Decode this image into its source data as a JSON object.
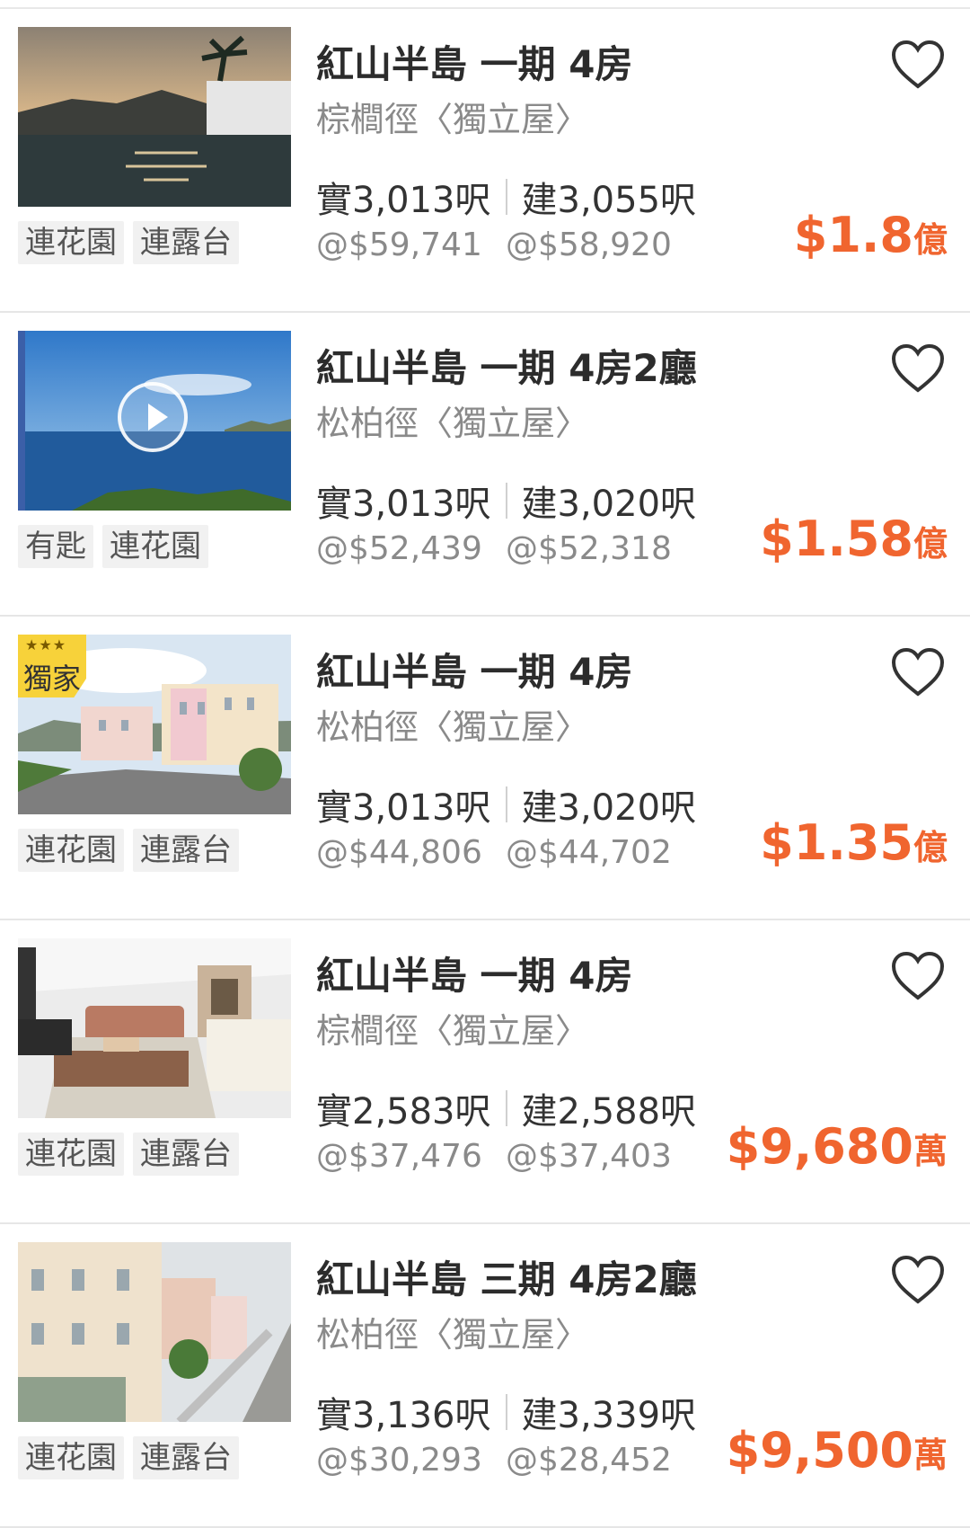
{
  "listings": [
    {
      "title": "紅山半島 一期 4房",
      "subtitle": "棕櫚徑〈獨立屋〉",
      "saleable_area": "實3,013呎",
      "gross_area": "建3,055呎",
      "saleable_price_per_ft": "@$59,741",
      "gross_price_per_ft": "@$58,920",
      "price": "$1.8",
      "price_unit": "億",
      "tags": [
        "連花園",
        "連露台"
      ],
      "image": "sunset-pool-photo",
      "has_video": false,
      "exclusive_badge": null
    },
    {
      "title": "紅山半島 一期 4房2廳",
      "subtitle": "松柏徑〈獨立屋〉",
      "saleable_area": "實3,013呎",
      "gross_area": "建3,020呎",
      "saleable_price_per_ft": "@$52,439",
      "gross_price_per_ft": "@$52,318",
      "price": "$1.58",
      "price_unit": "億",
      "tags": [
        "有匙",
        "連花園"
      ],
      "image": "sea-view-photo",
      "has_video": true,
      "exclusive_badge": null
    },
    {
      "title": "紅山半島 一期 4房",
      "subtitle": "松柏徑〈獨立屋〉",
      "saleable_area": "實3,013呎",
      "gross_area": "建3,020呎",
      "saleable_price_per_ft": "@$44,806",
      "gross_price_per_ft": "@$44,702",
      "price": "$1.35",
      "price_unit": "億",
      "tags": [
        "連花園",
        "連露台"
      ],
      "image": "street-houses-photo",
      "has_video": false,
      "exclusive_badge": {
        "stars": "★★★",
        "label": "獨家"
      }
    },
    {
      "title": "紅山半島 一期 4房",
      "subtitle": "棕櫚徑〈獨立屋〉",
      "saleable_area": "實2,583呎",
      "gross_area": "建2,588呎",
      "saleable_price_per_ft": "@$37,476",
      "gross_price_per_ft": "@$37,403",
      "price": "$9,680",
      "price_unit": "萬",
      "tags": [
        "連花園",
        "連露台"
      ],
      "image": "living-room-photo",
      "has_video": false,
      "exclusive_badge": null
    },
    {
      "title": "紅山半島 三期 4房2廳",
      "subtitle": "松柏徑〈獨立屋〉",
      "saleable_area": "實3,136呎",
      "gross_area": "建3,339呎",
      "saleable_price_per_ft": "@$30,293",
      "gross_price_per_ft": "@$28,452",
      "price": "$9,500",
      "price_unit": "萬",
      "tags": [
        "連花園",
        "連露台"
      ],
      "image": "hillside-houses-photo",
      "has_video": false,
      "exclusive_badge": null
    }
  ],
  "colors": {
    "price": "#f0652f",
    "tag_bg": "#f1f1f1",
    "divider": "#e6e6e6"
  },
  "icons": {
    "favorite": "heart-outline-icon",
    "video": "play-icon"
  }
}
